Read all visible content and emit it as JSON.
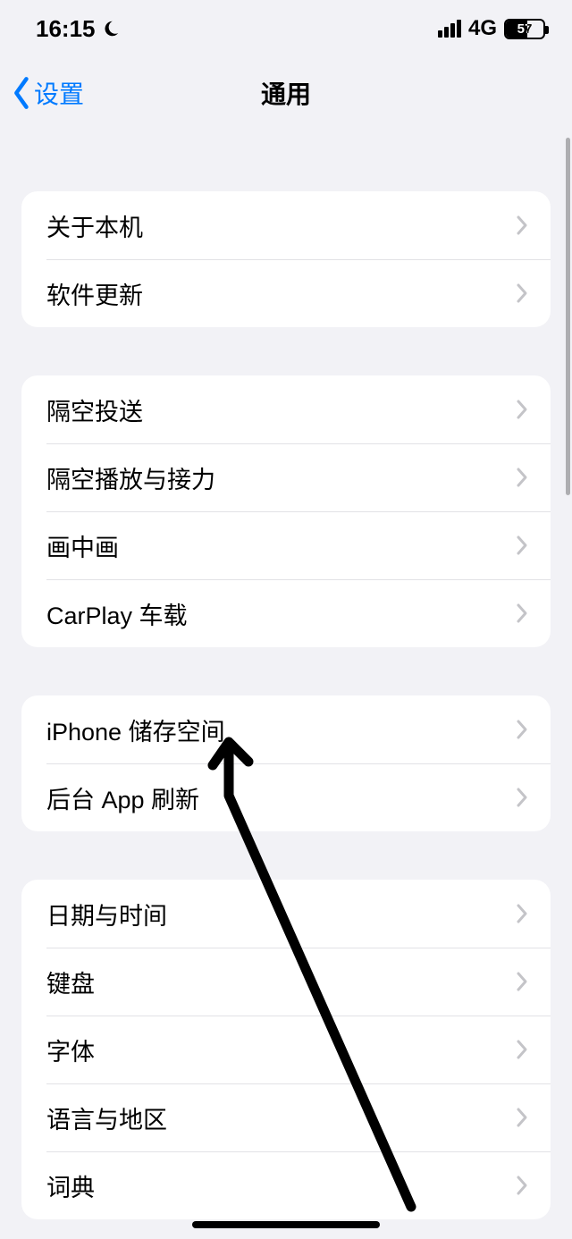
{
  "status": {
    "time": "16:15",
    "network": "4G",
    "battery_text": "57",
    "battery_percent": 57
  },
  "nav": {
    "back_label": "设置",
    "title": "通用"
  },
  "groups": [
    {
      "items": [
        {
          "id": "about",
          "label": "关于本机"
        },
        {
          "id": "software-update",
          "label": "软件更新"
        }
      ]
    },
    {
      "items": [
        {
          "id": "airdrop",
          "label": "隔空投送"
        },
        {
          "id": "airplay-handoff",
          "label": "隔空播放与接力"
        },
        {
          "id": "pip",
          "label": "画中画"
        },
        {
          "id": "carplay",
          "label": "CarPlay 车载"
        }
      ]
    },
    {
      "items": [
        {
          "id": "iphone-storage",
          "label": "iPhone 储存空间"
        },
        {
          "id": "background-refresh",
          "label": "后台 App 刷新"
        }
      ]
    },
    {
      "items": [
        {
          "id": "date-time",
          "label": "日期与时间"
        },
        {
          "id": "keyboard",
          "label": "键盘"
        },
        {
          "id": "fonts",
          "label": "字体"
        },
        {
          "id": "language-region",
          "label": "语言与地区"
        },
        {
          "id": "dictionary",
          "label": "词典"
        }
      ]
    }
  ]
}
